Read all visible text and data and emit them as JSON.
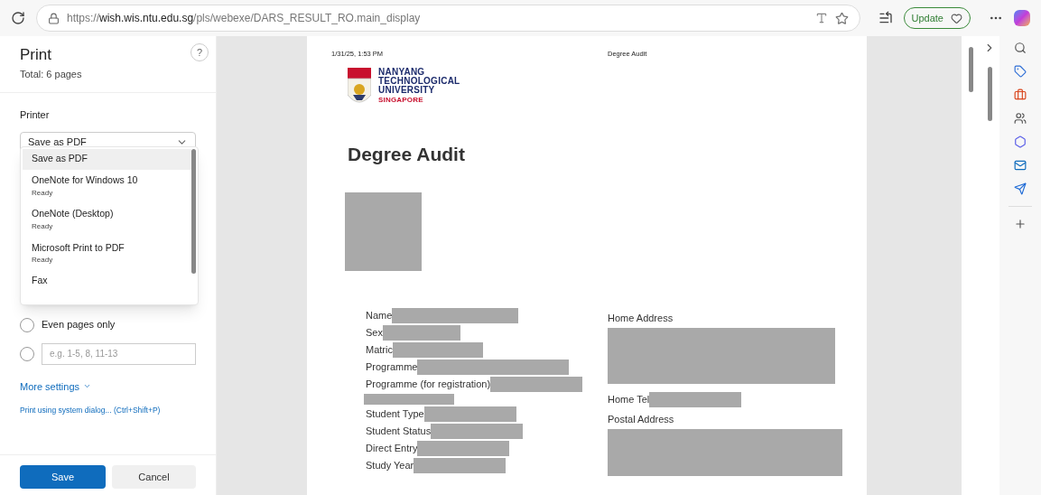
{
  "browser": {
    "url_scheme": "https://",
    "url_host": "wish.wis.ntu.edu.sg",
    "url_path": "/pls/webexe/DARS_RESULT_RO.main_display",
    "update_label": "Update"
  },
  "print_panel": {
    "title": "Print",
    "total": "Total: 6 pages",
    "help": "?",
    "printer_label": "Printer",
    "printer_value": "Save as PDF",
    "printer_options": [
      {
        "name": "Save as PDF",
        "selected": true
      },
      {
        "name": "OneNote for Windows 10",
        "status": "Ready",
        "selected": false
      },
      {
        "name": "OneNote (Desktop)",
        "status": "Ready",
        "selected": false
      },
      {
        "name": "Microsoft Print to PDF",
        "status": "Ready",
        "selected": false
      },
      {
        "name": "Fax",
        "selected": false
      }
    ],
    "page_options": [
      {
        "kind": "label",
        "label": "Even pages only",
        "selected": false
      },
      {
        "kind": "range",
        "placeholder": "e.g. 1-5, 8, 11-13",
        "selected": false
      }
    ],
    "more_settings": "More settings",
    "system_dialog": "Print using system dialog... (Ctrl+Shift+P)",
    "save": "Save",
    "cancel": "Cancel"
  },
  "document": {
    "header_date": "1/31/25, 1:53 PM",
    "header_title": "Degree Audit",
    "logo_lines": [
      "NANYANG",
      "TECHNOLOGICAL",
      "UNIVERSITY",
      "SINGAPORE"
    ],
    "heading": "Degree Audit",
    "left_fields": [
      {
        "kind": "inline",
        "label": "Name"
      },
      {
        "kind": "inline",
        "label": "Sex"
      },
      {
        "kind": "inline",
        "label": "Matric"
      },
      {
        "kind": "inline",
        "label": "Programme"
      },
      {
        "kind": "inline",
        "label": "Programme (for registration)"
      },
      {
        "kind": "blank"
      },
      {
        "kind": "inline",
        "label": "Student Type"
      },
      {
        "kind": "inline",
        "label": "Student Status"
      },
      {
        "kind": "inline",
        "label": "Direct Entry"
      },
      {
        "kind": "inline",
        "label": "Study Year"
      }
    ],
    "right_fields": [
      {
        "kind": "below",
        "label": "Home Address"
      },
      {
        "kind": "inline",
        "label": "Home Tel"
      },
      {
        "kind": "below",
        "label": "Postal Address"
      }
    ]
  }
}
